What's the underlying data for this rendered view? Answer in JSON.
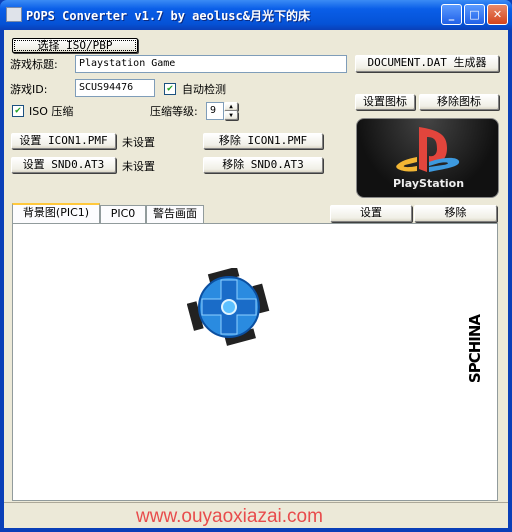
{
  "window": {
    "title": "POPS Converter v1.7 by aeolusc&月光下的床",
    "minimize": "_",
    "maximize": "□",
    "close": "✕"
  },
  "file": {
    "select_button": "选择 ISO/PBP"
  },
  "game": {
    "title_label": "游戏标题:",
    "title_value": "Playstation Game",
    "id_label": "游戏ID:",
    "id_value": "SCUS94476",
    "auto_detect_label": "自动检测",
    "auto_detect_checked": true
  },
  "document_button": "DOCUMENT.DAT 生成器",
  "icon_buttons": {
    "set": "设置图标",
    "remove": "移除图标"
  },
  "compression": {
    "iso_label": "ISO 压缩",
    "iso_checked": true,
    "level_label": "压缩等级:",
    "level_value": "9"
  },
  "icon1": {
    "set": "设置 ICON1.PMF",
    "status": "未设置",
    "remove": "移除 ICON1.PMF"
  },
  "snd0": {
    "set": "设置 SND0.AT3",
    "status": "未设置",
    "remove": "移除 SND0.AT3"
  },
  "preview_logo": {
    "text": "PlayStation"
  },
  "tabs": [
    {
      "label": "背景图(PIC1)",
      "active": true
    },
    {
      "label": "PIC0"
    },
    {
      "label": "警告画面"
    }
  ],
  "pic_buttons": {
    "set": "设置",
    "remove": "移除"
  },
  "background_image": {
    "logo_text": "SPCHINA"
  },
  "watermark": "www.ouyaoxiazai.com"
}
